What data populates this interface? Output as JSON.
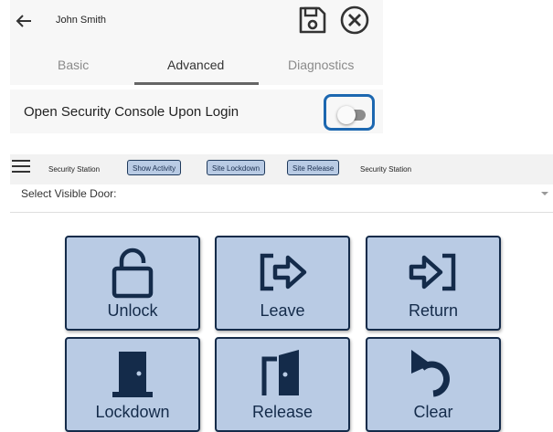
{
  "header": {
    "user_name": "John Smith"
  },
  "tabs": [
    {
      "label": "Basic",
      "active": false
    },
    {
      "label": "Advanced",
      "active": true
    },
    {
      "label": "Diagnostics",
      "active": false
    }
  ],
  "setting": {
    "label": "Open Security Console Upon Login",
    "enabled": false
  },
  "toolbar": {
    "left_title": "Security Station",
    "chips": [
      "Show Activity",
      "Site Lockdown",
      "Site Release"
    ],
    "right_title": "Security Station"
  },
  "door_select": {
    "label": "Select Visible Door:"
  },
  "tiles": [
    {
      "label": "Unlock",
      "icon": "padlock-open-icon"
    },
    {
      "label": "Leave",
      "icon": "leave-arrow-icon"
    },
    {
      "label": "Return",
      "icon": "return-arrow-icon"
    },
    {
      "label": "Lockdown",
      "icon": "closed-door-icon"
    },
    {
      "label": "Release",
      "icon": "open-door-icon"
    },
    {
      "label": "Clear",
      "icon": "undo-icon"
    }
  ],
  "colors": {
    "accent": "#1c67b0",
    "tile_bg": "#b9cbe4",
    "tile_ink": "#142b4a"
  }
}
